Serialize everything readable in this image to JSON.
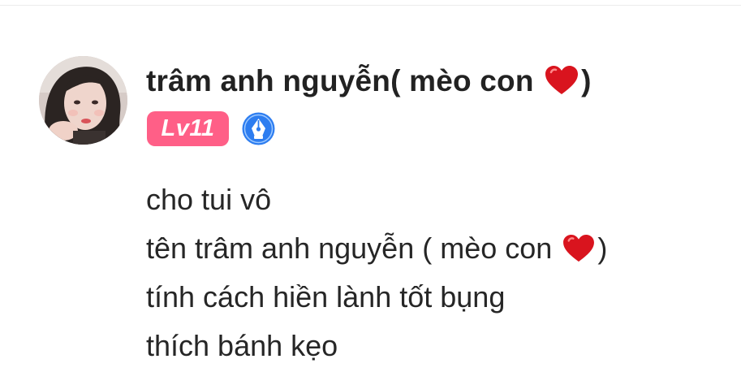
{
  "comment": {
    "username": "trâm anh nguyễn( mèo con",
    "username_suffix": ")",
    "level": "Lv11",
    "lines": [
      {
        "text": "cho tui vô",
        "suffix": ""
      },
      {
        "text": "tên trâm anh nguyễn ( mèo con",
        "suffix": ")"
      },
      {
        "text": "tính cách hiền lành tốt bụng",
        "suffix": ""
      },
      {
        "text": "thích bánh kẹo",
        "suffix": ""
      }
    ],
    "icons": {
      "heart": "red-heart-emoji",
      "verified": "pen-nib-badge-icon"
    },
    "colors": {
      "level_badge": "#ff5f87",
      "verified_badge": "#2d7df0",
      "heart": "#d9141e"
    }
  }
}
